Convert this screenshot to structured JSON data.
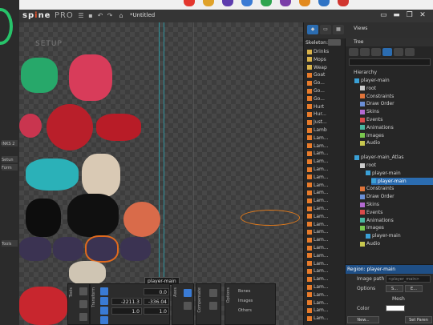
{
  "app": {
    "logo_text": "sp",
    "logo_dot": "i",
    "logo_tail": "ne",
    "edition": "PRO",
    "filename": "*Untitled",
    "mode_label": "SETUP"
  },
  "desktop": {
    "labels": [
      "INKS 2",
      "Setun",
      "Form",
      "Tools"
    ]
  },
  "top_panel": {
    "views_label": "Views",
    "tree_label": "Tree",
    "skeletons_label": "Skeleton:"
  },
  "skeleton_list": [
    "Drinks",
    "Mops",
    "Weap",
    "Goat",
    "Go...",
    "Go...",
    "Go...",
    "Hurt",
    "Hur...",
    "Just...",
    "Lamb",
    "Lam...",
    "Lam...",
    "Lam...",
    "Lam...",
    "Lam...",
    "Lam...",
    "Lam...",
    "Lam...",
    "Lam...",
    "Lam...",
    "Lam...",
    "Lam...",
    "Lam...",
    "Lam...",
    "Lam...",
    "Lam...",
    "Lam...",
    "Lam...",
    "Lam...",
    "Lam...",
    "Lam...",
    "Lam...",
    "Lam...",
    "Lam...",
    "Lam..."
  ],
  "tree": {
    "search_placeholder": "",
    "hierarchy_label": "Hierarchy",
    "nodes": [
      {
        "label": "player-main",
        "indent": 1
      },
      {
        "label": "root",
        "indent": 2
      },
      {
        "label": "Constraints",
        "indent": 2
      },
      {
        "label": "Draw Order",
        "indent": 2
      },
      {
        "label": "Skins",
        "indent": 2
      },
      {
        "label": "Events",
        "indent": 2
      },
      {
        "label": "Animations",
        "indent": 2
      },
      {
        "label": "Images",
        "indent": 2
      },
      {
        "label": "Audio",
        "indent": 2
      },
      {
        "label": "player-main_Atlas",
        "indent": 1
      },
      {
        "label": "root",
        "indent": 2
      },
      {
        "label": "player-main",
        "indent": 3
      },
      {
        "label": "player-main",
        "indent": 4,
        "selected": true
      },
      {
        "label": "Constraints",
        "indent": 2
      },
      {
        "label": "Draw Order",
        "indent": 2
      },
      {
        "label": "Skins",
        "indent": 2
      },
      {
        "label": "Events",
        "indent": 2
      },
      {
        "label": "Animations",
        "indent": 2
      },
      {
        "label": "Images",
        "indent": 2
      },
      {
        "label": "player-main",
        "indent": 3
      },
      {
        "label": "Audio",
        "indent": 2
      }
    ]
  },
  "region_panel": {
    "title": "Region: player-main",
    "image_path_label": "Image path",
    "image_path_value": "<player_main>",
    "options_label": "Options",
    "opt1": "S...",
    "opt2": "E...",
    "mesh_label": "Mesh",
    "color_label": "Color",
    "new_button": "New...",
    "set_parent_button": "Set Paren"
  },
  "viewport": {
    "region_tag": "player-main"
  },
  "transform": {
    "rotate": "0.0",
    "translate_x": "-2211.3",
    "translate_y": "-336.04",
    "scale_x": "1.0",
    "scale_y": "1.0"
  },
  "tools_labels": {
    "tools": "Tools",
    "transform": "Transform",
    "axes": "Axes",
    "compensate": "Compensate",
    "options": "Options"
  },
  "options_rows": [
    "Bones",
    "Images",
    "Others"
  ]
}
